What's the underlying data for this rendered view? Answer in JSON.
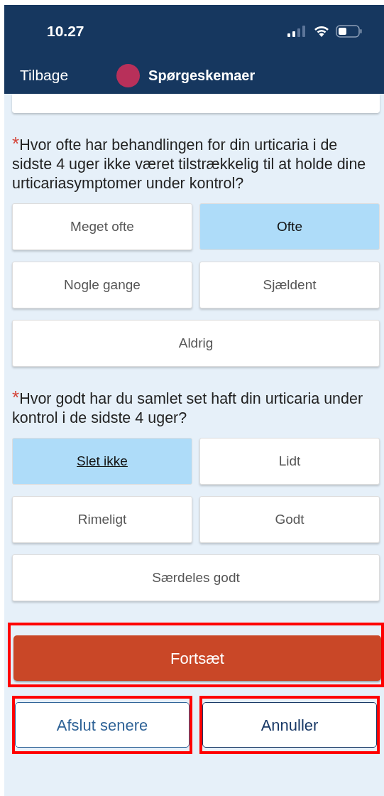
{
  "status_bar": {
    "time": "10.27"
  },
  "nav": {
    "back": "Tilbage",
    "title": "Spørgeskemaer"
  },
  "questions": [
    {
      "required_mark": "*",
      "text": "Hvor ofte har behandlingen for din urticaria i de sidste 4 uger ikke været tilstrækkelig til at holde dine urticariasymptomer under kontrol?",
      "options": [
        {
          "label": "Meget ofte",
          "selected": false,
          "kind": "half"
        },
        {
          "label": "Ofte",
          "selected": true,
          "kind": "half"
        },
        {
          "label": "Nogle gange",
          "selected": false,
          "kind": "half"
        },
        {
          "label": "Sjældent",
          "selected": false,
          "kind": "half"
        },
        {
          "label": "Aldrig",
          "selected": false,
          "kind": "full"
        }
      ]
    },
    {
      "required_mark": "*",
      "text": "Hvor godt har du samlet set haft din urticaria under kontrol i de sidste 4 uger?",
      "options": [
        {
          "label": "Slet ikke",
          "selected": true,
          "kind": "half"
        },
        {
          "label": "Lidt",
          "selected": false,
          "kind": "half"
        },
        {
          "label": "Rimeligt",
          "selected": false,
          "kind": "half"
        },
        {
          "label": "Godt",
          "selected": false,
          "kind": "half"
        },
        {
          "label": "Særdeles godt",
          "selected": false,
          "kind": "full"
        }
      ]
    }
  ],
  "actions": [
    {
      "label": "Fortsæt",
      "kind": "primary",
      "highlighted": true
    },
    {
      "label": "Afslut senere",
      "kind": "outline-light",
      "highlighted": true
    },
    {
      "label": "Annuller",
      "kind": "outline-dark",
      "highlighted": true
    }
  ]
}
